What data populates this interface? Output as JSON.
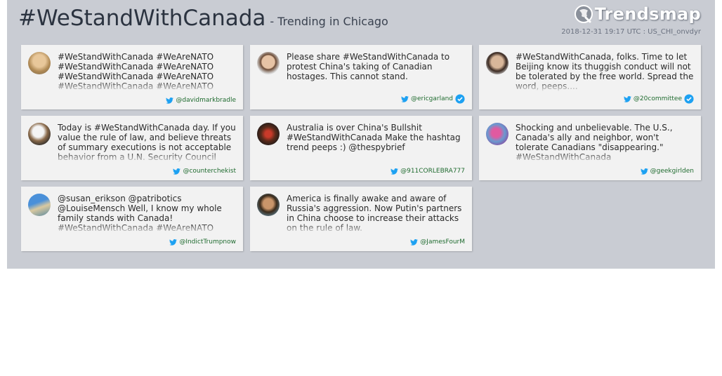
{
  "header": {
    "hashtag": "#WeStandWithCanada",
    "subtitle": "- Trending in Chicago",
    "timestamp": "2018-12-31 19:17 UTC : US_CHI_onvdyr",
    "brand": "Trendsmap"
  },
  "colors": {
    "panel_bg": "#c9ccd3",
    "card_bg": "#f2f2f2",
    "twitter_blue": "#1da1f2",
    "handle_green": "#1f6b2f"
  },
  "tweets": [
    {
      "text": "#WeStandWithCanada #WeAreNATO #WeStandWithCanada #WeAreNATO #WeStandWithCanada #WeAreNATO #WeStandWithCanada #WeAreNATO",
      "handle": "@davidmarkbradle",
      "verified": false
    },
    {
      "text": "Please share #WeStandWithCanada to protest China's taking of Canadian hostages. This cannot stand.",
      "handle": "@ericgarland",
      "verified": true
    },
    {
      "text": "#WeStandWithCanada, folks. Time to let Beijing know its thuggish conduct will not be tolerated by the free world. Spread the word, peeps....",
      "handle": "@20committee",
      "verified": true
    },
    {
      "text": "Today is #WeStandWithCanada day. If you value the rule of law, and believe threats of summary executions is not acceptable behavior from a U.N. Security Council",
      "handle": "@counterchekist",
      "verified": false
    },
    {
      "text": "Australia is over China's Bullshit #WeStandWithCanada Make the hashtag trend peeps :) @thespybrief",
      "handle": "@911CORLEBRA777",
      "verified": false
    },
    {
      "text": "Shocking and unbelievable. The U.S., Canada's ally and neighbor, won't tolerate Canadians \"disappearing.\" #WeStandWithCanada",
      "handle": "@geekgirlden",
      "verified": false
    },
    {
      "text": "@susan_erikson @patribotics @LouiseMensch Well, I know my whole family stands with Canada! #WeStandWithCanada #WeAreNATO",
      "handle": "@IndictTrumpnow",
      "verified": false
    },
    {
      "text": "America is finally awake and aware of Russia's aggression. Now Putin's partners in China choose to increase their attacks on the rule of law.",
      "handle": "@JamesFourM",
      "verified": false
    }
  ]
}
